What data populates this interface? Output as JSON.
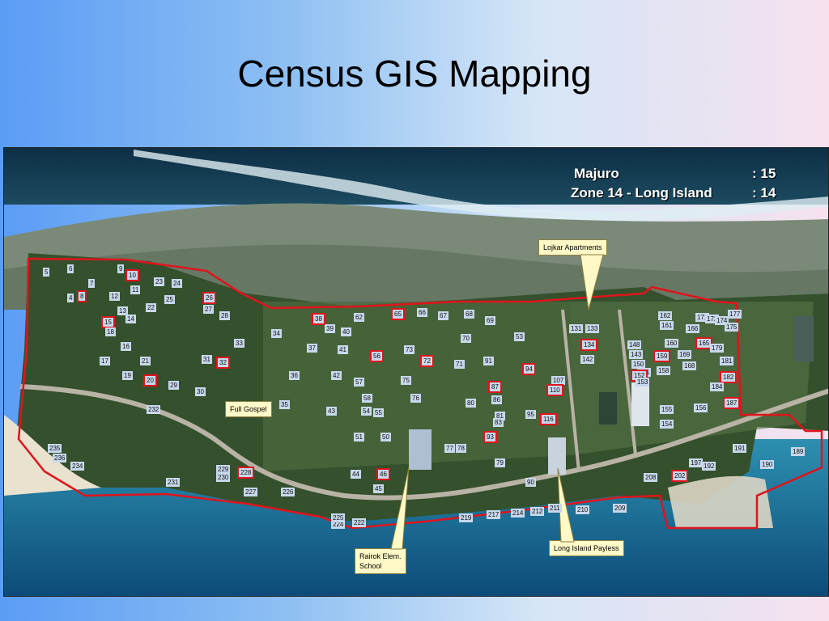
{
  "title": "Census GIS Mapping",
  "info": {
    "line1_label": "Majuro",
    "line1_value": ":   15",
    "line2_label": "Zone 14 - Long Island",
    "line2_value": ":   14"
  },
  "callouts": {
    "lojkar": "Lojkar Apartments",
    "full_gospel": "Full Gospel",
    "rairok": "Rairok Elem.\nSchool",
    "payless": "Long Island Payless"
  },
  "buildings": [
    {
      "n": "5",
      "red": false
    },
    {
      "n": "6",
      "red": false
    },
    {
      "n": "7",
      "red": false
    },
    {
      "n": "9",
      "red": false
    },
    {
      "n": "10",
      "red": true
    },
    {
      "n": "11",
      "red": false
    },
    {
      "n": "4",
      "red": false
    },
    {
      "n": "8",
      "red": true
    },
    {
      "n": "12",
      "red": false
    },
    {
      "n": "13",
      "red": false
    },
    {
      "n": "14",
      "red": false
    },
    {
      "n": "15",
      "red": true
    },
    {
      "n": "16",
      "red": false
    },
    {
      "n": "17",
      "red": false
    },
    {
      "n": "18",
      "red": false
    },
    {
      "n": "19",
      "red": false
    },
    {
      "n": "20",
      "red": true
    },
    {
      "n": "21",
      "red": false
    },
    {
      "n": "22",
      "red": false
    },
    {
      "n": "23",
      "red": false
    },
    {
      "n": "24",
      "red": false
    },
    {
      "n": "25",
      "red": false
    },
    {
      "n": "26",
      "red": true
    },
    {
      "n": "27",
      "red": false
    },
    {
      "n": "28",
      "red": false
    },
    {
      "n": "29",
      "red": false
    },
    {
      "n": "30",
      "red": false
    },
    {
      "n": "31",
      "red": false
    },
    {
      "n": "32",
      "red": true
    },
    {
      "n": "33",
      "red": false
    },
    {
      "n": "34",
      "red": false
    },
    {
      "n": "35",
      "red": false
    },
    {
      "n": "36",
      "red": false
    },
    {
      "n": "37",
      "red": false
    },
    {
      "n": "38",
      "red": true
    },
    {
      "n": "39",
      "red": false
    },
    {
      "n": "40",
      "red": false
    },
    {
      "n": "41",
      "red": false
    },
    {
      "n": "42",
      "red": false
    },
    {
      "n": "43",
      "red": false
    },
    {
      "n": "44",
      "red": false
    },
    {
      "n": "45",
      "red": false
    },
    {
      "n": "46",
      "red": true
    },
    {
      "n": "50",
      "red": false
    },
    {
      "n": "51",
      "red": false
    },
    {
      "n": "53",
      "red": false
    },
    {
      "n": "54",
      "red": false
    },
    {
      "n": "55",
      "red": false
    },
    {
      "n": "56",
      "red": true
    },
    {
      "n": "57",
      "red": false
    },
    {
      "n": "58",
      "red": false
    },
    {
      "n": "62",
      "red": false
    },
    {
      "n": "65",
      "red": true
    },
    {
      "n": "66",
      "red": false
    },
    {
      "n": "67",
      "red": false
    },
    {
      "n": "68",
      "red": false
    },
    {
      "n": "69",
      "red": false
    },
    {
      "n": "70",
      "red": false
    },
    {
      "n": "71",
      "red": false
    },
    {
      "n": "72",
      "red": true
    },
    {
      "n": "73",
      "red": false
    },
    {
      "n": "75",
      "red": false
    },
    {
      "n": "76",
      "red": false
    },
    {
      "n": "77",
      "red": false
    },
    {
      "n": "78",
      "red": false
    },
    {
      "n": "79",
      "red": false
    },
    {
      "n": "80",
      "red": false
    },
    {
      "n": "81",
      "red": false
    },
    {
      "n": "83",
      "red": false
    },
    {
      "n": "86",
      "red": false
    },
    {
      "n": "87",
      "red": true
    },
    {
      "n": "90",
      "red": false
    },
    {
      "n": "91",
      "red": false
    },
    {
      "n": "93",
      "red": true
    },
    {
      "n": "94",
      "red": true
    },
    {
      "n": "95",
      "red": false
    },
    {
      "n": "107",
      "red": false
    },
    {
      "n": "110",
      "red": true
    },
    {
      "n": "116",
      "red": true
    },
    {
      "n": "131",
      "red": false
    },
    {
      "n": "133",
      "red": false
    },
    {
      "n": "134",
      "red": true
    },
    {
      "n": "142",
      "red": false
    },
    {
      "n": "143",
      "red": false
    },
    {
      "n": "148",
      "red": false
    },
    {
      "n": "150",
      "red": false
    },
    {
      "n": "151",
      "red": false
    },
    {
      "n": "152",
      "red": true
    },
    {
      "n": "153",
      "red": false
    },
    {
      "n": "154",
      "red": false
    },
    {
      "n": "155",
      "red": false
    },
    {
      "n": "156",
      "red": false
    },
    {
      "n": "158",
      "red": false
    },
    {
      "n": "159",
      "red": true
    },
    {
      "n": "160",
      "red": false
    },
    {
      "n": "161",
      "red": false
    },
    {
      "n": "162",
      "red": false
    },
    {
      "n": "165",
      "red": true
    },
    {
      "n": "166",
      "red": false
    },
    {
      "n": "168",
      "red": false
    },
    {
      "n": "169",
      "red": false
    },
    {
      "n": "171",
      "red": false
    },
    {
      "n": "172",
      "red": false
    },
    {
      "n": "174",
      "red": false
    },
    {
      "n": "175",
      "red": false
    },
    {
      "n": "177",
      "red": false
    },
    {
      "n": "179",
      "red": false
    },
    {
      "n": "181",
      "red": false
    },
    {
      "n": "182",
      "red": true
    },
    {
      "n": "184",
      "red": false
    },
    {
      "n": "187",
      "red": true
    },
    {
      "n": "189",
      "red": false
    },
    {
      "n": "190",
      "red": false
    },
    {
      "n": "191",
      "red": false
    },
    {
      "n": "192",
      "red": false
    },
    {
      "n": "197",
      "red": false
    },
    {
      "n": "202",
      "red": true
    },
    {
      "n": "208",
      "red": false
    },
    {
      "n": "209",
      "red": false
    },
    {
      "n": "210",
      "red": false
    },
    {
      "n": "211",
      "red": false
    },
    {
      "n": "212",
      "red": false
    },
    {
      "n": "214",
      "red": false
    },
    {
      "n": "217",
      "red": false
    },
    {
      "n": "219",
      "red": false
    },
    {
      "n": "222",
      "red": false
    },
    {
      "n": "224",
      "red": false
    },
    {
      "n": "225",
      "red": false
    },
    {
      "n": "226",
      "red": false
    },
    {
      "n": "227",
      "red": false
    },
    {
      "n": "228",
      "red": true
    },
    {
      "n": "229",
      "red": false
    },
    {
      "n": "230",
      "red": false
    },
    {
      "n": "231",
      "red": false
    },
    {
      "n": "232",
      "red": false
    },
    {
      "n": "234",
      "red": false
    },
    {
      "n": "235",
      "red": false
    },
    {
      "n": "236",
      "red": false
    }
  ]
}
